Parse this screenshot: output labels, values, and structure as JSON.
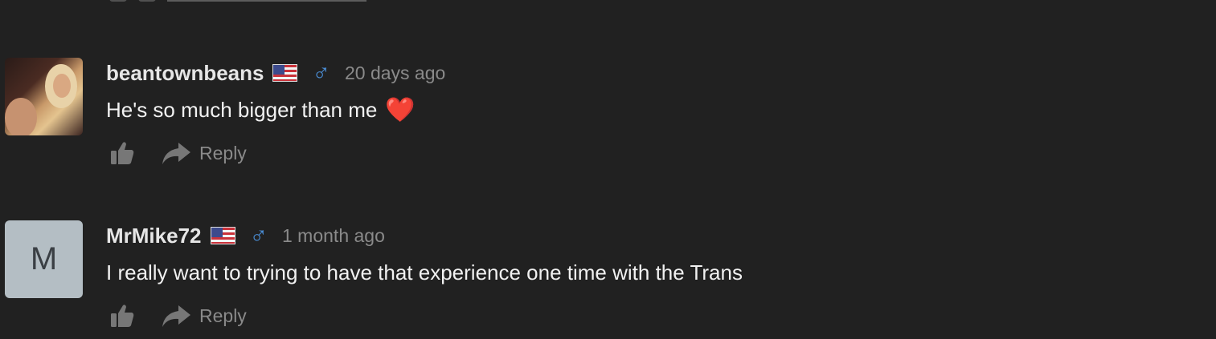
{
  "comments": [
    {
      "username": "beantownbeans",
      "time": "20 days ago",
      "text": "He's so much bigger than me",
      "gender_icon": "male-symbol",
      "flag": "us-flag",
      "reaction": "❤️",
      "reply_label": "Reply"
    },
    {
      "username": "MrMike72",
      "avatar_letter": "M",
      "time": "1 month ago",
      "text": "I really want to trying to have that experience one time with the Trans",
      "gender_icon": "male-symbol",
      "flag": "us-flag",
      "reply_label": "Reply"
    }
  ],
  "symbols": {
    "male": "♂"
  },
  "colors": {
    "background": "#212121",
    "gender_icon": "#4b8fd8",
    "muted_text": "#8a8a8a",
    "avatar_letter_bg": "#b4bec4"
  }
}
